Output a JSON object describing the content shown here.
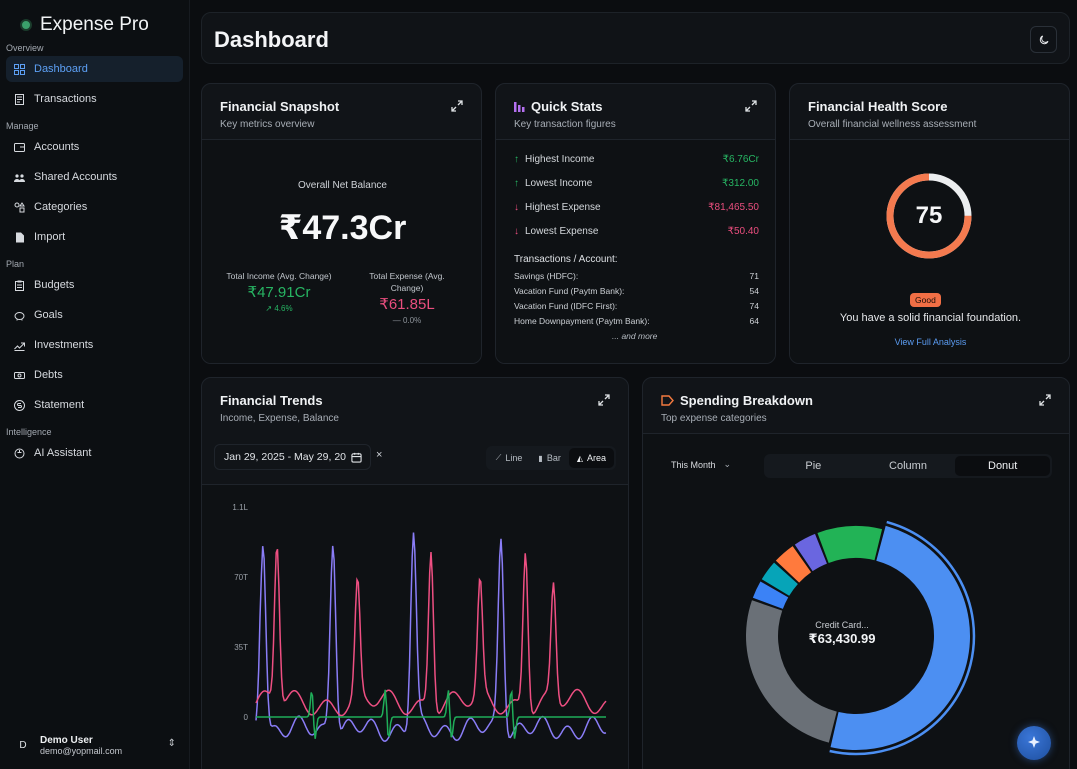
{
  "brand": {
    "title": "Expense Pro"
  },
  "nav": {
    "sections": [
      {
        "label": "Overview",
        "items": [
          {
            "label": "Dashboard",
            "icon": "grid-icon",
            "active": true
          },
          {
            "label": "Transactions",
            "icon": "receipt-icon"
          }
        ]
      },
      {
        "label": "Manage",
        "items": [
          {
            "label": "Accounts",
            "icon": "wallet-icon"
          },
          {
            "label": "Shared Accounts",
            "icon": "users-icon"
          },
          {
            "label": "Categories",
            "icon": "shapes-icon"
          },
          {
            "label": "Import",
            "icon": "file-import-icon"
          }
        ]
      },
      {
        "label": "Plan",
        "items": [
          {
            "label": "Budgets",
            "icon": "clipboard-icon"
          },
          {
            "label": "Goals",
            "icon": "piggy-bank-icon"
          },
          {
            "label": "Investments",
            "icon": "trending-icon"
          },
          {
            "label": "Debts",
            "icon": "banknote-icon"
          },
          {
            "label": "Statement",
            "icon": "dollar-circle-icon"
          }
        ]
      },
      {
        "label": "Intelligence",
        "items": [
          {
            "label": "AI Assistant",
            "icon": "bot-icon"
          }
        ]
      }
    ]
  },
  "user": {
    "initial": "D",
    "name": "Demo User",
    "email": "demo@yopmail.com"
  },
  "header": {
    "title": "Dashboard"
  },
  "snapshot": {
    "title": "Financial Snapshot",
    "subtitle": "Key metrics overview",
    "net_label": "Overall Net Balance",
    "net_value": "₹47.3Cr",
    "income_label": "Total Income (Avg. Change)",
    "income_value": "₹47.91Cr",
    "income_change": "4.6%",
    "expense_label": "Total Expense (Avg. Change)",
    "expense_value": "₹61.85L",
    "expense_change": "0.0%"
  },
  "quick_stats": {
    "title": "Quick Stats",
    "subtitle": "Key transaction figures",
    "rows": [
      {
        "label": "Highest Income",
        "value": "₹6.76Cr",
        "dir": "up"
      },
      {
        "label": "Lowest Income",
        "value": "₹312.00",
        "dir": "up"
      },
      {
        "label": "Highest Expense",
        "value": "₹81,465.50",
        "dir": "down"
      },
      {
        "label": "Lowest Expense",
        "value": "₹50.40",
        "dir": "down"
      }
    ],
    "accounts_header": "Transactions / Account:",
    "accounts": [
      {
        "name": "Savings (HDFC):",
        "count": "71"
      },
      {
        "name": "Vacation Fund (Paytm Bank):",
        "count": "54"
      },
      {
        "name": "Vacation Fund (IDFC First):",
        "count": "74"
      },
      {
        "name": "Home Downpayment (Paytm Bank):",
        "count": "64"
      }
    ],
    "more": "... and more"
  },
  "health": {
    "title": "Financial Health Score",
    "subtitle": "Overall financial wellness assessment",
    "score": 75,
    "score_text": "75",
    "badge": "Good",
    "message": "You have a solid financial foundation.",
    "link": "View Full Analysis",
    "colors": {
      "arc": "#f47a4f",
      "track": "#eceef0"
    }
  },
  "trends": {
    "title": "Financial Trends",
    "subtitle": "Income, Expense, Balance",
    "date_range": "Jan 29, 2025 - May 29, 20",
    "clear": "×",
    "modes": [
      {
        "label": "Line",
        "icon": "line-icon"
      },
      {
        "label": "Bar",
        "icon": "bar-icon"
      },
      {
        "label": "Area",
        "icon": "area-icon",
        "on": true
      }
    ],
    "y_ticks": [
      "1.1L",
      "70T",
      "35T",
      "0"
    ],
    "colors": {
      "income": "#8a7df7",
      "expense": "#ee4f82",
      "balance": "#1fae59"
    }
  },
  "spending": {
    "title": "Spending Breakdown",
    "subtitle": "Top expense categories",
    "period": "This Month",
    "tabs": [
      {
        "label": "Pie"
      },
      {
        "label": "Column"
      },
      {
        "label": "Donut",
        "on": true
      }
    ],
    "center_label": "Credit Card...",
    "center_value": "₹63,430.99",
    "slices": [
      {
        "value": 63430.99,
        "color": "#4c8ff2"
      },
      {
        "value": 34000,
        "color": "#6a7077"
      },
      {
        "value": 3800,
        "color": "#3b82f6"
      },
      {
        "value": 4300,
        "color": "#06a4b8"
      },
      {
        "value": 4600,
        "color": "#ff7a3d"
      },
      {
        "value": 4700,
        "color": "#6a66e0"
      },
      {
        "value": 12600,
        "color": "#22b356"
      }
    ]
  }
}
